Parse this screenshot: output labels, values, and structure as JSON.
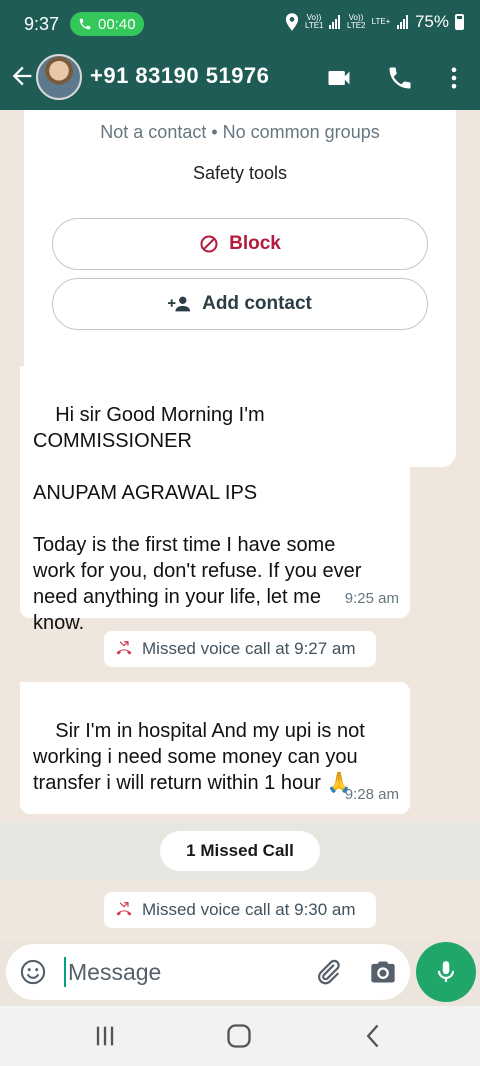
{
  "status_bar": {
    "time": "9:37",
    "call_timer": "00:40",
    "sim1_label": "Vo)) LTE1",
    "sim2_label": "Vo)) LTE2",
    "lte_label": "LTE+",
    "battery": "75%"
  },
  "header": {
    "contact_name": "+91 83190 51976"
  },
  "info_card": {
    "subtitle": "Not a contact • No common groups",
    "safety_tools": "Safety tools",
    "block_label": "Block",
    "add_contact_label": "Add contact"
  },
  "messages": [
    {
      "text": "Hi sir Good Morning I'm\nCOMMISSIONER\n\nANUPAM AGRAWAL IPS\n\nToday is the first time I have some\nwork for you, don't refuse. If you ever\nneed anything in your life, let me\nknow.",
      "time": "9:25 am"
    },
    {
      "text": "Sir I'm in hospital And my upi is not\nworking i need some money can you\ntransfer i will return within 1 hour 🙏",
      "time": "9:28 am"
    }
  ],
  "system_messages": {
    "missed_call_1": "Missed voice call at 9:27 am",
    "missed_call_summary": "1 Missed Call",
    "missed_call_2": "Missed voice call at 9:30 am"
  },
  "composer": {
    "placeholder": "Message"
  },
  "colors": {
    "header_bg": "#1f5c55",
    "accent_green": "#21a66a",
    "block_red": "#b31b3c",
    "chat_bg": "#efe7de"
  },
  "icons": [
    "back-arrow-icon",
    "video-call-icon",
    "phone-icon",
    "more-vert-icon",
    "block-icon",
    "add-person-icon",
    "missed-call-icon",
    "emoji-icon",
    "attach-icon",
    "camera-icon",
    "mic-icon",
    "recents-icon",
    "home-icon",
    "back-nav-icon"
  ]
}
